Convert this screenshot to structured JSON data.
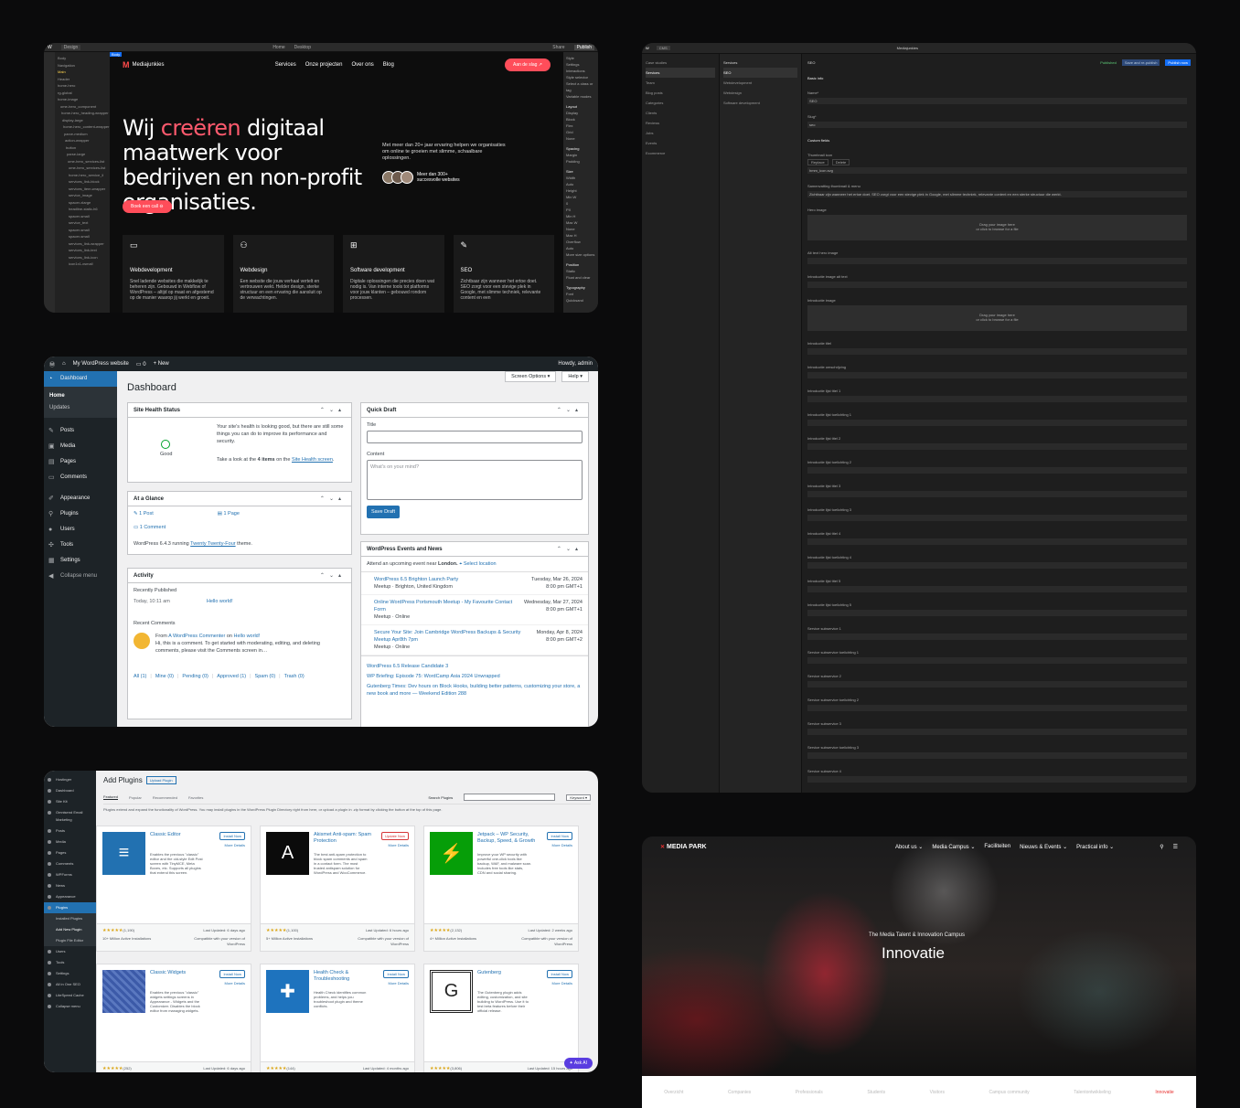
{
  "webflow": {
    "topbar": {
      "mode": "Design",
      "breakpoint": "Home",
      "device": "Desktop",
      "share": "Share",
      "publish": "Publish",
      "body_tag": "Body"
    },
    "navigator": [
      "Body",
      "Navigation",
      "Main",
      "Header",
      "home-hero",
      "rg-global",
      "home-image",
      "ome-hero_component",
      "home-hero_heading-wrapper",
      "display-large",
      "home-hero_content-wrapper",
      "parce-medium",
      "action-wrapper",
      "button",
      "parse-large",
      "ome-hero_services-list",
      "ome-hero_services-list",
      "home-hero_service_li",
      "services_link-block",
      "services_item-wrapper",
      "service_image",
      "spacer-xlarge",
      "headline-static-h6",
      "spacer-small",
      "service_text",
      "spacer-small",
      "spacer-small",
      "services_link-wrapper",
      "services_link-text",
      "services_link-icon",
      "icon1x1-xsmall"
    ],
    "site": {
      "brand": "Mediajunkies",
      "links": [
        "Services",
        "Onze projecten",
        "Over ons",
        "Blog"
      ],
      "cta": "Aan de slag",
      "headline_1": "Wij ",
      "headline_pink": "creëren",
      "headline_2": " digitaal maatwerk voor bedrijven en non-profit organisaties.",
      "intro": "Met meer dan 20+ jaar ervaring helpen we organisaties om online te groeien met slimme, schaalbare oplossingen.",
      "proof": "Meer dan 300+ succesvolle websites",
      "book": "Boek een call",
      "cards": [
        {
          "title": "Webdevelopment",
          "text": "Snel ladende websites die makkelijk te beheren zijn. Gebouwd in Webflow of WordPress – altijd op maat en afgestemd op de manier waarop jij werkt en groeit."
        },
        {
          "title": "Webdesign",
          "text": "Een website die jouw verhaal vertelt en vertrouwen wekt. Helder design, sterke structuur en een ervaring die aansluit op de verwachtingen."
        },
        {
          "title": "Software development",
          "text": "Digitale oplossingen die precies doen wat nodig is. Van interne tools tot platforms voor jouw klanten – gebouwd rondom processen."
        },
        {
          "title": "SEO",
          "text": "Zichtbaar zijn wanneer het ertoe doet. SEO zorgt voor een stevige plek in Google, met slimme techniek, relevante content en een"
        }
      ]
    },
    "style_panel": [
      "Style",
      "Settings",
      "Interactions",
      "Style selector",
      "Select a class or tag",
      "Variable modes",
      "Layout",
      "Display",
      "Block",
      "Flex",
      "Grid",
      "None",
      "Spacing",
      "Margin",
      "Padding",
      "Size",
      "Width",
      "Auto",
      "Height",
      "Min W",
      "0",
      "PX",
      "Min H",
      "Max W",
      "None",
      "Max H",
      "Overflow",
      "Auto",
      "More size options",
      "Position",
      "Static",
      "Float and clear",
      "Typography",
      "Font",
      "Quicksand"
    ]
  },
  "cms": {
    "title": "Mediajunkies",
    "collections_label": "CMS",
    "collections": [
      "Case studies",
      "Services",
      "Team",
      "Blog posts",
      "Categories",
      "Clients",
      "Reviews",
      "Jobs",
      "Events",
      "Ecommerce"
    ],
    "services_label": "Services",
    "services": [
      "SEO",
      "Webdevelopment",
      "Webdesign",
      "Software development"
    ],
    "item_title": "SEO",
    "status": "Published",
    "save": "Save and re-publish",
    "publish": "Publish now",
    "fields": [
      "Basic info",
      "Name*",
      "SEO",
      "Slug*",
      "seo",
      "Custom fields",
      "Thumbnail icon",
      "hmm_icon.svg",
      "Samenvatting thumbnail & menu",
      "Zichtbaar zijn wanneer het ertoe doet. SEO zorgt voor een stevige plek in Google, met slimme techniek, relevante content en een sterke structuur die werkt.",
      "Hero image",
      "Alt text hero image",
      "Introductie image alt text",
      "Introductie image",
      "Introductie titel",
      "Introductie omschrijving",
      "Introductie lijst titel 1",
      "Introductie lijst toelichting 1",
      "Introductie lijst titel 2",
      "Introductie lijst toelichting 2",
      "Introductie lijst titel 3",
      "Introductie lijst toelichting 3",
      "Introductie lijst titel 4",
      "Introductie lijst toelichting 4",
      "Introductie lijst titel 5",
      "Introductie lijst toelichting 5",
      "Service subservice 1",
      "Service subservice toelichting 1",
      "Service subservice 2",
      "Service subservice toelichting 2",
      "Service subservice 3",
      "Service subservice toelichting 3",
      "Service subservice 4",
      "Service subservice toelichting 4",
      "Service subservice 5"
    ],
    "drop": "Drag your image here",
    "drop_sub": "or click to browse for a file",
    "replace": "Replace",
    "delete": "Delete"
  },
  "wp": {
    "site": "My WordPress website",
    "comments": "0",
    "new": "New",
    "howdy": "Howdy, admin",
    "menu": {
      "dashboard": "Dashboard",
      "home": "Home",
      "updates": "Updates",
      "posts": "Posts",
      "media": "Media",
      "pages": "Pages",
      "comments": "Comments",
      "appearance": "Appearance",
      "plugins": "Plugins",
      "users": "Users",
      "tools": "Tools",
      "settings": "Settings",
      "collapse": "Collapse menu"
    },
    "screen_options": "Screen Options",
    "help": "Help",
    "title": "Dashboard",
    "health": {
      "title": "Site Health Status",
      "status": "Good",
      "text": "Your site's health is looking good, but there are still some things you can do to improve its performance and security.",
      "look": "Take a look at the ",
      "items": "4 items",
      "on": " on the ",
      "link": "Site Health screen",
      "dot": "."
    },
    "glance": {
      "title": "At a Glance",
      "post": "1 Post",
      "page": "1 Page",
      "comment": "1 Comment",
      "running": "WordPress 6.4.3 running ",
      "theme": "Twenty Twenty-Four",
      "theme_suffix": " theme."
    },
    "activity": {
      "title": "Activity",
      "recent": "Recently Published",
      "time": "Today, 10:11 am",
      "hello": "Hello world!",
      "recent_comments": "Recent Comments",
      "from": "From ",
      "commenter": "A WordPress Commenter",
      "on": " on ",
      "post": "Hello world!",
      "comment": "Hi, this is a comment. To get started with moderating, editing, and deleting comments, please visit the Comments screen in…",
      "filters": [
        "All (1)",
        "Mine (0)",
        "Pending (0)",
        "Approved (1)",
        "Spam (0)",
        "Trash (0)"
      ]
    },
    "draft": {
      "title": "Quick Draft",
      "label_title": "Title",
      "label_content": "Content",
      "placeholder": "What's on your mind?",
      "save": "Save Draft"
    },
    "events": {
      "title": "WordPress Events and News",
      "attend": "Attend an upcoming event near ",
      "city": "London.",
      "select": "Select location",
      "list": [
        {
          "name": "WordPress 6.5 Brighton Launch Party",
          "where": "Meetup · Brighton, United Kingdom",
          "date": "Tuesday, Mar 26, 2024",
          "time": "8:00 pm GMT+1"
        },
        {
          "name": "Online WordPress Portsmouth Meetup - My Favourite Contact Form",
          "where": "Meetup · Online",
          "date": "Wednesday, Mar 27, 2024",
          "time": "8:00 pm GMT+1"
        },
        {
          "name": "Secure Your Site: Join Cambridge WordPress Backups & Security Meetup Apr8th 7pm",
          "where": "Meetup · Online",
          "date": "Monday, Apr 8, 2024",
          "time": "8:00 pm GMT+2"
        }
      ],
      "news": [
        "WordPress 6.5 Release Candidate 3",
        "WP Briefing: Episode 75: WordCamp Asia 2024 Unwrapped",
        "Gutenberg Times: Dev hours on Block Hooks, building better patterns, customizing your store, a new book and more — Weekend Edition 288"
      ]
    }
  },
  "plugins": {
    "title": "Add Plugins",
    "upload": "Upload Plugin",
    "side": [
      "Hostinger",
      "Dashboard",
      "Site Kit",
      "Omnisend Email Marketing",
      "Posts",
      "Media",
      "Pages",
      "Comments",
      "WPForms",
      "News",
      "Appearance",
      "Plugins",
      "Installed Plugins",
      "Add New Plugin",
      "Plugin File Editor",
      "Users",
      "Tools",
      "Settings",
      "All in One SEO",
      "LiteSpeed Cache",
      "Collapse menu"
    ],
    "tabs": [
      "Featured",
      "Popular",
      "Recommended",
      "Favorites"
    ],
    "search_label": "Search Plugins",
    "keyword": "Keyword",
    "intro": "Plugins extend and expand the functionality of WordPress. You may install plugins in the WordPress Plugin Directory right from here, or upload a plugin in .zip format by clicking the button at the top of this page.",
    "cards": [
      {
        "name": "Classic Editor",
        "desc": "Enables the previous \"classic\" editor and the old-style Edit Post screen with TinyMCE, Meta Boxes, etc. Supports all plugins that extend this screen.",
        "by": "By WordPress Contributors",
        "rating": "(1,190)",
        "installs": "10+ Million Active Installations",
        "updated": "Last Updated: 6 days ago",
        "compat": "Compatible with your version of WordPress",
        "btn": "Install Now"
      },
      {
        "name": "Akismet Anti-spam: Spam Protection",
        "desc": "The best anti-spam protection to block spam comments and spam in a contact form. The most trusted antispam solution for WordPress and WooCommerce.",
        "by": "By Automattic - Anti-spam Team",
        "rating": "(1,100)",
        "installs": "5+ Million Active Installations",
        "updated": "Last Updated: 6 hours ago",
        "compat": "Compatible with your version of WordPress",
        "btn": "Update Now"
      },
      {
        "name": "Jetpack – WP Security, Backup, Speed, & Growth",
        "desc": "Improve your WP security with powerful one-click tools like backup, WAF, and malware scan. Includes free tools like stats, CDN and social sharing.",
        "by": "By Automattic",
        "rating": "(2,132)",
        "installs": "4+ Million Active Installations",
        "updated": "Last Updated: 2 weeks ago",
        "compat": "Compatible with your version of WordPress",
        "btn": "Install Now"
      },
      {
        "name": "Classic Widgets",
        "desc": "Enables the previous \"classic\" widgets settings screens in Appearance - Widgets and the Customizer. Disables the block editor from managing widgets.",
        "by": "By WordPress Contributors",
        "rating": "(252)",
        "installs": "2+ Million Active Installations",
        "updated": "Last Updated: 6 days ago",
        "compat": "Compatible with your version of WordPress",
        "btn": "Install Now"
      },
      {
        "name": "Health Check & Troubleshooting",
        "desc": "Health Check identifies common problems, and helps you troubleshoot plugin and theme conflicts.",
        "by": "By The WordPress.org community",
        "rating": "(144)",
        "installs": "300,000+ Active Installations",
        "updated": "Last Updated: 4 months ago",
        "compat": "Compatible with your version of WordPress",
        "btn": "Install Now"
      },
      {
        "name": "Gutenberg",
        "desc": "The Gutenberg plugin adds editing, customization, and site building to WordPress. Use it to test beta features before their official release.",
        "by": "By Gutenberg Team",
        "rating": "(3,806)",
        "installs": "300,000+ Active Installations",
        "updated": "Last Updated: 15 hours ago",
        "compat": "Compatible with your version of WordPress",
        "btn": "Install Now"
      }
    ],
    "more": "More Details",
    "ask": "Ask AI"
  },
  "mediapark": {
    "brand": "MEDIA PARK",
    "links": [
      "About us",
      "Media Campus",
      "Faciliteiten",
      "Nieuws & Events",
      "Practical info"
    ],
    "kicker": "The Media Talent & Innovation Campus",
    "title": "Innovatie",
    "tabs": [
      "Overzicht",
      "Companies",
      "Professionals",
      "Students",
      "Visitors",
      "Campus community",
      "Talentontwikkeling",
      "Innovatie"
    ]
  },
  "colors": {
    "wp_blue": "#2271b1",
    "wp_dark": "#1d2327",
    "mj_red": "#ff4d5a",
    "mp_accent": "#e8302f"
  }
}
